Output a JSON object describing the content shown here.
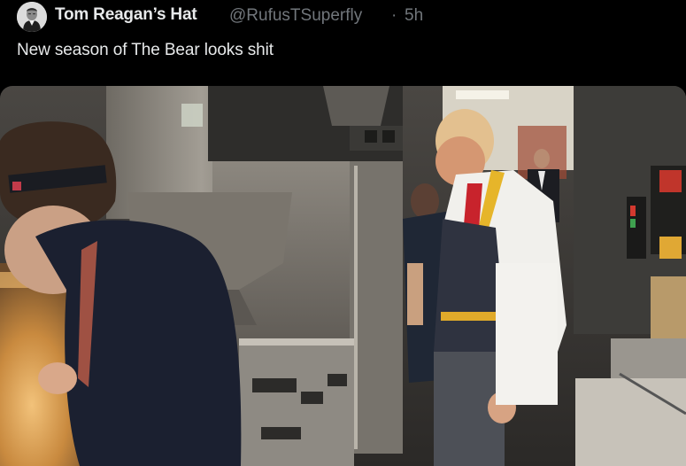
{
  "tweet": {
    "display_name": "Tom Reagan’s Hat",
    "handle": "@RufusTSuperfly",
    "separator": "·",
    "time": "5h",
    "text": "New season of The Bear looks shit"
  },
  "icons": {
    "avatar": "profile-photo"
  },
  "colors": {
    "background": "#000000",
    "primary_text": "#e7e9ea",
    "secondary_text": "#71767b"
  }
}
